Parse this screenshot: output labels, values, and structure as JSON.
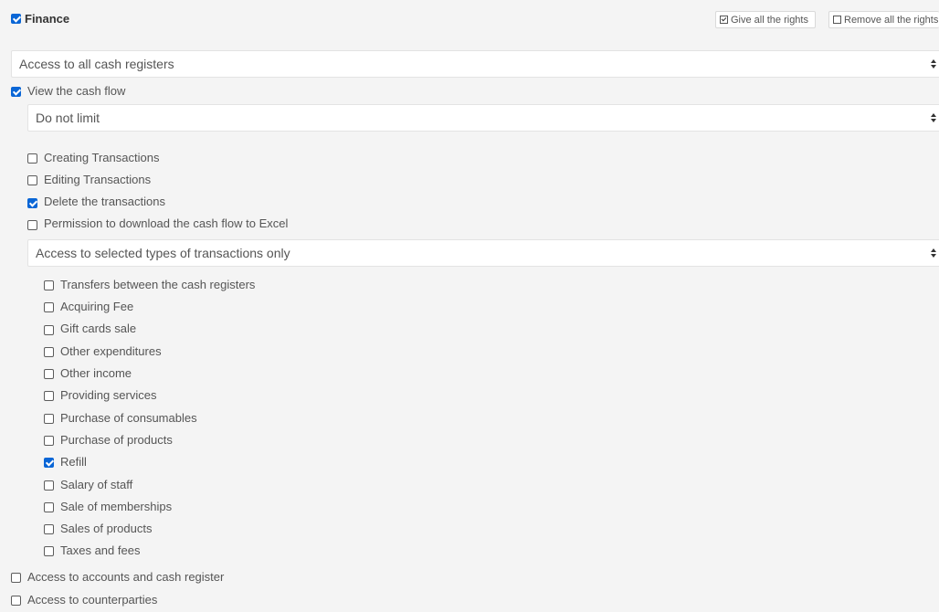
{
  "section": {
    "title": "Finance",
    "checked": true
  },
  "rights_buttons": {
    "give": {
      "label": "Give all the rights",
      "checked": true
    },
    "remove": {
      "label": "Remove all the rights",
      "checked": false
    }
  },
  "cash_registers_select": {
    "value": "Access to all cash registers"
  },
  "view_cash_flow": {
    "label": "View the cash flow",
    "checked": true
  },
  "limit_select": {
    "value": "Do not limit"
  },
  "permissions": [
    {
      "label": "Creating Transactions",
      "checked": false
    },
    {
      "label": "Editing Transactions",
      "checked": false
    },
    {
      "label": "Delete the transactions",
      "checked": true
    },
    {
      "label": "Permission to download the cash flow to Excel",
      "checked": false
    }
  ],
  "transaction_types_select": {
    "value": "Access to selected types of transactions only"
  },
  "transaction_types": [
    {
      "label": "Transfers between the cash registers",
      "checked": false
    },
    {
      "label": "Acquiring Fee",
      "checked": false
    },
    {
      "label": "Gift cards sale",
      "checked": false
    },
    {
      "label": "Other expenditures",
      "checked": false
    },
    {
      "label": "Other income",
      "checked": false
    },
    {
      "label": "Providing services",
      "checked": false
    },
    {
      "label": "Purchase of consumables",
      "checked": false
    },
    {
      "label": "Purchase of products",
      "checked": false
    },
    {
      "label": "Refill",
      "checked": true
    },
    {
      "label": "Salary of staff",
      "checked": false
    },
    {
      "label": "Sale of memberships",
      "checked": false
    },
    {
      "label": "Sales of products",
      "checked": false
    },
    {
      "label": "Taxes and fees",
      "checked": false
    }
  ],
  "bottom_options": [
    {
      "label": "Access to accounts and cash register",
      "checked": false
    },
    {
      "label": "Access to counterparties",
      "checked": false
    }
  ],
  "colors": {
    "accent": "#0a66d6",
    "background": "#f4f4f4",
    "text": "#555555"
  }
}
